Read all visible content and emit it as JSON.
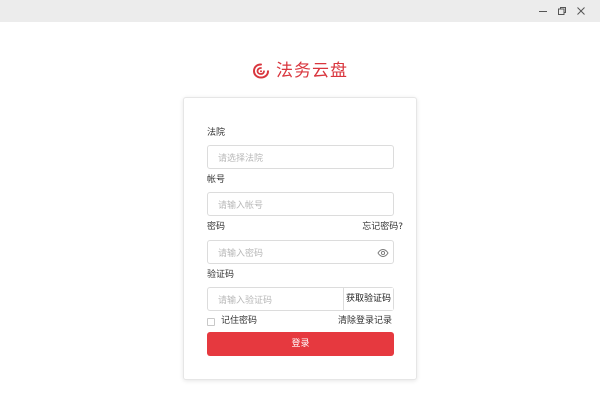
{
  "window": {
    "controls": {
      "minimize_icon": "minimize-icon",
      "restore_icon": "restore-icon",
      "close_icon": "close-icon"
    }
  },
  "brand": {
    "title": "法务云盘",
    "logo_icon": "cloud-swirl-logo-icon",
    "color": "#d9363e"
  },
  "form": {
    "court": {
      "label": "法院",
      "placeholder": "请选择法院",
      "value": ""
    },
    "account": {
      "label": "帐号",
      "placeholder": "请输入帐号",
      "value": ""
    },
    "password": {
      "label": "密码",
      "placeholder": "请输入密码",
      "value": "",
      "forgot_link": "忘记密码?",
      "toggle_icon": "eye-icon"
    },
    "code": {
      "label": "验证码",
      "placeholder": "请输入验证码",
      "value": "",
      "get_code_button": "获取验证码"
    },
    "remember": {
      "label": "记住密码",
      "checked": false
    },
    "clear_link": "清除登录记录",
    "submit_label": "登录",
    "accent_color": "#e6393f"
  }
}
